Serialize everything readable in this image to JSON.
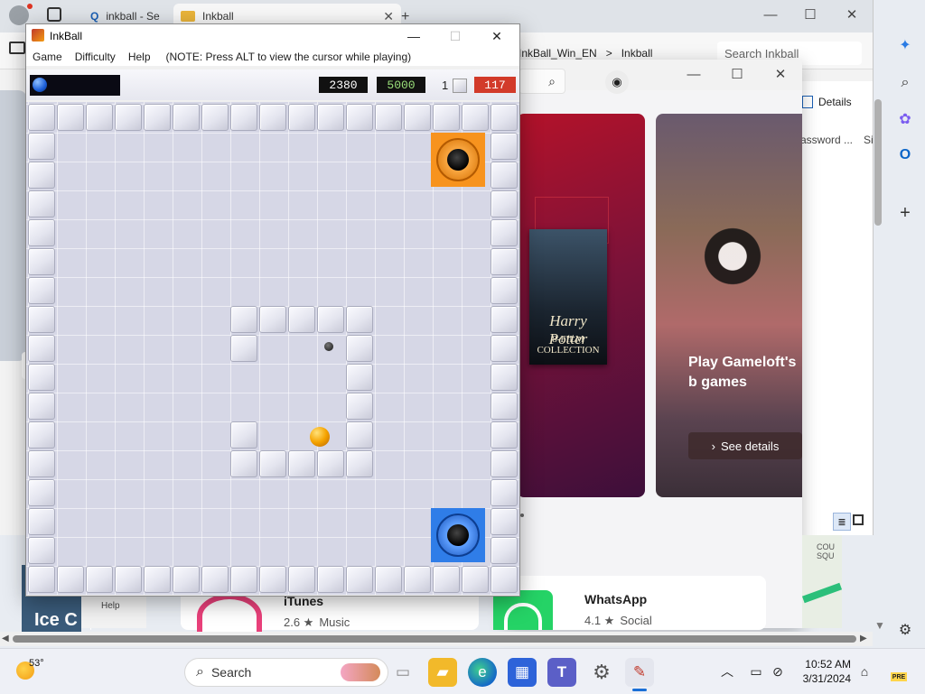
{
  "browser": {
    "tabs": [
      {
        "label": "inkball - Se",
        "icon": "search-icon"
      },
      {
        "label": "Inkball",
        "icon": "folder-icon",
        "close": "✕"
      }
    ],
    "new_tab": "+",
    "controls": {
      "minimize": "—",
      "maximize": "☐",
      "close": "✕"
    },
    "breadcrumb": [
      "InkBall_Win_EN",
      ">",
      "Inkball"
    ],
    "search_placeholder": "Search Inkball",
    "details_label": "Details",
    "password_col": "assword ...",
    "size_col": "Si"
  },
  "store": {
    "controls": {
      "minimize": "—",
      "maximize": "☐",
      "close": "✕"
    },
    "promo_movie": {
      "title": "Harry Potter",
      "subtitle": "8-FILM COLLECTION"
    },
    "promo_game": {
      "title": "Play Gameloft's b games",
      "button": "See details"
    },
    "bottom_left_text": "Ice C",
    "help_label": "Help",
    "apps": [
      {
        "name": "iTunes",
        "rating": "2.6 ★",
        "category": "Music"
      },
      {
        "name": "WhatsApp",
        "rating": "4.1 ★",
        "category": "Social"
      }
    ],
    "map_label": "COU SQU"
  },
  "inkball": {
    "title": "InkBall",
    "controls": {
      "minimize": "—",
      "maximize": "☐",
      "close": "✕"
    },
    "menu": [
      "Game",
      "Difficulty",
      "Help"
    ],
    "note": "(NOTE: Press ALT to view the cursor while playing)",
    "score": "2380",
    "goal": "5000",
    "lives": "1",
    "time": "117",
    "colors": {
      "score": "#ffffff",
      "goal": "#9ae07a",
      "time_bg": "#d23a2a",
      "orange_hole": "#f7931e",
      "blue_hole": "#2f7de8",
      "ball": "#f5a300"
    }
  },
  "taskbar": {
    "weather": "53°",
    "search_label": "Search",
    "time": "10:52 AM",
    "date": "3/31/2024",
    "apps": [
      "file-explorer-icon",
      "edge-icon",
      "store-icon",
      "teams-icon",
      "settings-icon",
      "inkball-icon"
    ]
  }
}
